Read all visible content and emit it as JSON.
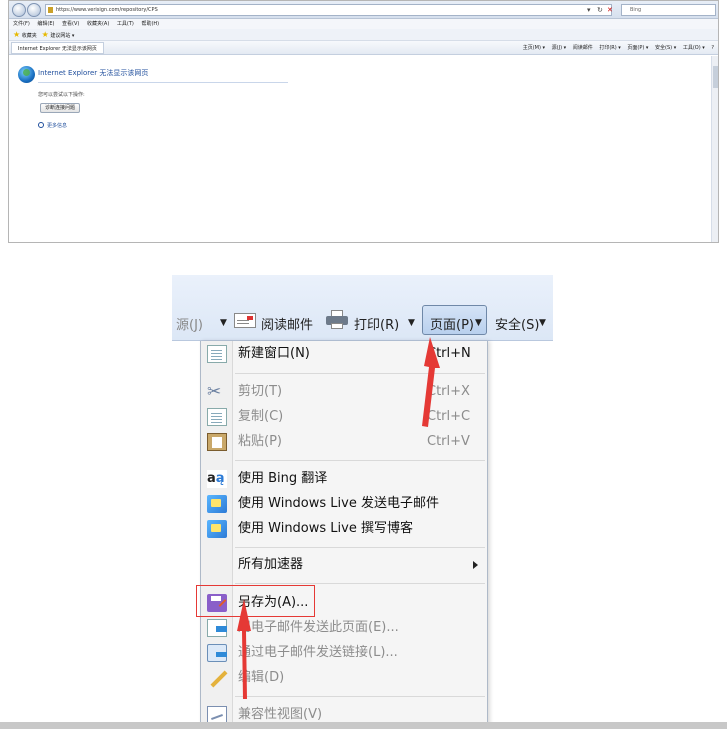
{
  "browser": {
    "url": "https://www.verisign.com/repository/CPS",
    "search_placeholder": "Bing",
    "menu": [
      "文件(F)",
      "编辑(E)",
      "查看(V)",
      "收藏夹(A)",
      "工具(T)",
      "帮助(H)"
    ],
    "favorites": {
      "label": "收藏夹",
      "suggested": "建议网站 ▾"
    },
    "tab_title": "Internet Explorer 无法显示该网页",
    "commands": [
      "主页(M) ▾",
      "源(J) ▾",
      "阅读邮件",
      "打印(R) ▾",
      "页面(P) ▾",
      "安全(S) ▾",
      "工具(O) ▾",
      "?"
    ],
    "error": {
      "title": "Internet Explorer 无法显示该网页",
      "subtitle": "您可以尝试以下操作:",
      "diagnose_button": "诊断连接问题",
      "more_info": "更多信息"
    }
  },
  "zoom": {
    "commandbar": {
      "feeds": "源(J)",
      "read_mail": "阅读邮件",
      "print": "打印(R)",
      "page": "页面(P)",
      "safety": "安全(S)"
    },
    "menu": {
      "new_window": {
        "label": "新建窗口(N)",
        "shortcut": "Ctrl+N"
      },
      "cut": {
        "label": "剪切(T)",
        "shortcut": "Ctrl+X"
      },
      "copy": {
        "label": "复制(C)",
        "shortcut": "Ctrl+C"
      },
      "paste": {
        "label": "粘贴(P)",
        "shortcut": "Ctrl+V"
      },
      "bing_translate": {
        "label": "使用 Bing 翻译"
      },
      "wl_email": {
        "label": "使用 Windows Live 发送电子邮件"
      },
      "wl_blog": {
        "label": "使用 Windows Live 撰写博客"
      },
      "accelerators": {
        "label": "所有加速器"
      },
      "save_as": {
        "label": "另存为(A)..."
      },
      "send_page": {
        "label": "用电子邮件发送此页面(E)..."
      },
      "send_link": {
        "label": "通过电子邮件发送链接(L)..."
      },
      "edit": {
        "label": "编辑(D)"
      },
      "compat_view": {
        "label": "兼容性视图(V)"
      }
    }
  },
  "colors": {
    "highlight": "#e53935",
    "link_blue": "#1f4e9c"
  }
}
